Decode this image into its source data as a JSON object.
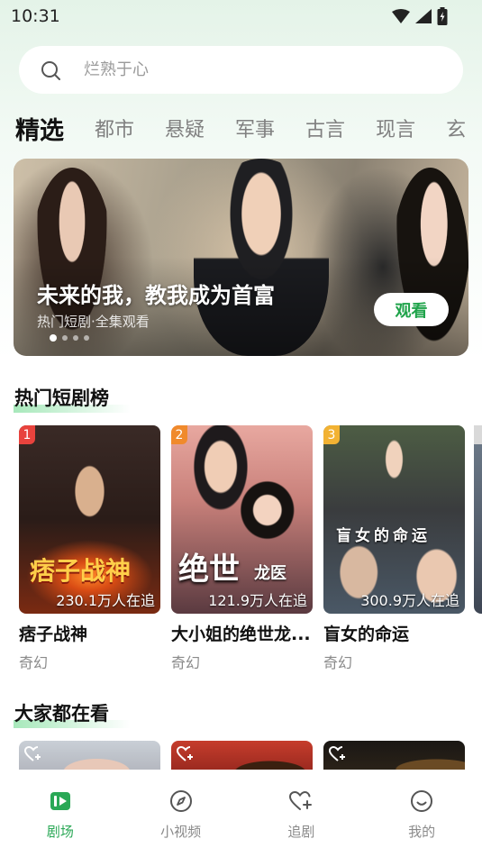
{
  "status_bar": {
    "time": "10:31"
  },
  "search": {
    "placeholder": "烂熟于心"
  },
  "tabs": [
    "精选",
    "都市",
    "悬疑",
    "军事",
    "古言",
    "现言",
    "玄"
  ],
  "banner": {
    "title": "未来的我，教我成为首富",
    "subtitle": "热门短剧·全集观看",
    "button_label": "观看",
    "slide_count": 4,
    "active_slide": 1
  },
  "sections": {
    "hot_rank": "热门短剧榜",
    "everyone_watching": "大家都在看"
  },
  "hot_dramas": [
    {
      "rank": "1",
      "title": "痞子战神",
      "genre": "奇幻",
      "followers": "230.1万人在追",
      "poster_text": "痞子战神",
      "badge_color": "#e8433d"
    },
    {
      "rank": "2",
      "title": "大小姐的绝世龙...",
      "genre": "奇幻",
      "followers": "121.9万人在追",
      "poster_text": "绝世",
      "poster_text2": "龙医",
      "badge_color": "#f08a2c"
    },
    {
      "rank": "3",
      "title": "盲女的命运",
      "genre": "奇幻",
      "followers": "300.9万人在追",
      "poster_text": "盲女的命运",
      "badge_color": "#f2b233"
    }
  ],
  "bottom_nav": [
    {
      "label": "剧场",
      "icon": "theater-icon",
      "active": true
    },
    {
      "label": "小视频",
      "icon": "compass-icon",
      "active": false
    },
    {
      "label": "追剧",
      "icon": "heart-plus-icon",
      "active": false
    },
    {
      "label": "我的",
      "icon": "smiley-icon",
      "active": false
    }
  ],
  "colors": {
    "accent": "#2aa856",
    "background_top": "#e4f3e8"
  }
}
